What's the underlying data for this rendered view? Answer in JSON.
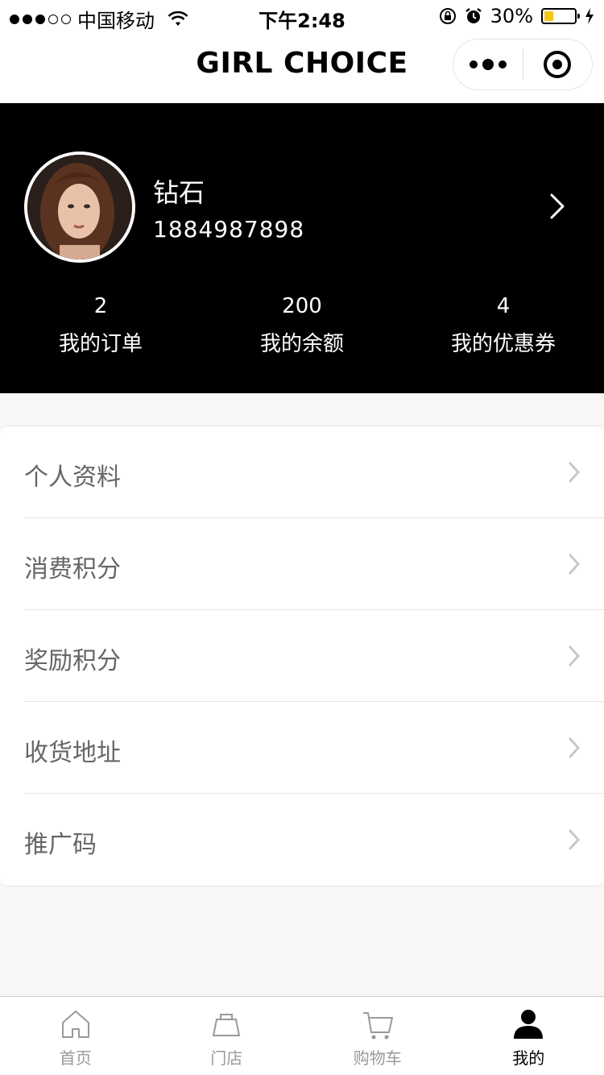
{
  "status_bar": {
    "carrier": "中国移动",
    "time": "下午2:48",
    "battery_percent": "30%",
    "battery_level": 0.3,
    "battery_color": "#f5c518"
  },
  "nav": {
    "title": "GIRL CHOICE",
    "more_icon": "more-dots-icon",
    "close_icon": "target-icon"
  },
  "profile": {
    "name": "钻石",
    "phone": "1884987898",
    "stats": [
      {
        "value": "2",
        "label": "我的订单"
      },
      {
        "value": "200",
        "label": "我的余额"
      },
      {
        "value": "4",
        "label": "我的优惠券"
      }
    ]
  },
  "menu": {
    "items": [
      {
        "label": "个人资料"
      },
      {
        "label": "消费积分"
      },
      {
        "label": "奖励积分"
      },
      {
        "label": "收货地址"
      },
      {
        "label": "推广码"
      }
    ]
  },
  "tabbar": {
    "items": [
      {
        "label": "首页",
        "icon": "home-icon",
        "active": false
      },
      {
        "label": "门店",
        "icon": "store-icon",
        "active": false
      },
      {
        "label": "购物车",
        "icon": "cart-icon",
        "active": false
      },
      {
        "label": "我的",
        "icon": "user-icon",
        "active": true
      }
    ]
  },
  "colors": {
    "header_bg": "#000000",
    "page_bg": "#f7f7f7",
    "menu_text": "#666666",
    "tab_inactive": "#999999",
    "tab_active": "#000000"
  }
}
